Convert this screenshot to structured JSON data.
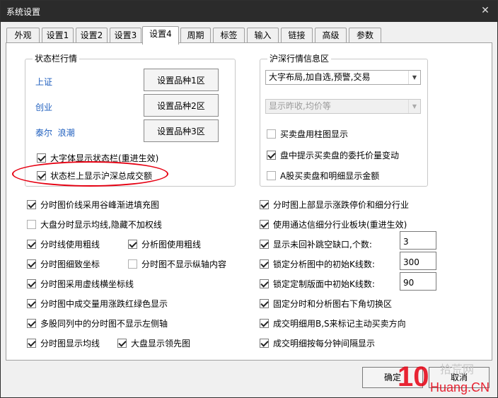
{
  "window": {
    "title": "系统设置",
    "close_glyph": "✕"
  },
  "tabs": [
    {
      "label": "外观",
      "active": false
    },
    {
      "label": "设置1",
      "active": false
    },
    {
      "label": "设置2",
      "active": false
    },
    {
      "label": "设置3",
      "active": false
    },
    {
      "label": "设置4",
      "active": true
    },
    {
      "label": "周期",
      "active": false
    },
    {
      "label": "标签",
      "active": false
    },
    {
      "label": "输入",
      "active": false
    },
    {
      "label": "链接",
      "active": false
    },
    {
      "label": "高级",
      "active": false
    },
    {
      "label": "参数",
      "active": false
    }
  ],
  "statusbar_group": {
    "title": "状态栏行情",
    "rows": [
      {
        "label": "上证",
        "button": "设置品种1区"
      },
      {
        "label": "创业",
        "button": "设置品种2区"
      },
      {
        "label": "泰尔  浪潮",
        "button": "设置品种3区"
      }
    ],
    "checks": [
      {
        "label": "大字体显示状态栏(重进生效)",
        "checked": true
      },
      {
        "label": "状态栏上显示沪深总成交额",
        "checked": true
      }
    ]
  },
  "hushen_group": {
    "title": "沪深行情信息区",
    "combo1": "大字布局,加自选,预警,交易",
    "combo2": "显示昨收,均价等",
    "checks": [
      {
        "label": "买卖盘用柱图显示",
        "checked": false
      },
      {
        "label": "盘中提示买卖盘的委托价量变动",
        "checked": true
      },
      {
        "label": "A股买卖盘和明细显示金额",
        "checked": false
      }
    ]
  },
  "left_options": {
    "row1": {
      "label": "分时图价线采用谷峰渐进填充图",
      "checked": true
    },
    "row2": {
      "label": "大盘分时显示均线,隐藏不加权线",
      "checked": false
    },
    "row3a": {
      "label": "分时线使用粗线",
      "checked": true
    },
    "row3b": {
      "label": "分析图使用粗线",
      "checked": true
    },
    "row4a": {
      "label": "分时图细致坐标",
      "checked": true
    },
    "row4b": {
      "label": "分时图不显示纵轴内容",
      "checked": false
    },
    "row5": {
      "label": "分时图采用虚线横坐标线",
      "checked": true
    },
    "row6": {
      "label": "分时图中成交量用涨跌红绿色显示",
      "checked": true
    },
    "row7": {
      "label": "多股同列中的分时图不显示左侧轴",
      "checked": true
    },
    "row8a": {
      "label": "分时图显示均线",
      "checked": true
    },
    "row8b": {
      "label": "大盘显示领先图",
      "checked": true
    }
  },
  "right_options": {
    "row1": {
      "label": "分时图上部显示涨跌停价和细分行业",
      "checked": true
    },
    "row2": {
      "label": "使用通达信细分行业板块(重进生效)",
      "checked": true
    },
    "row3": {
      "label": "显示未回补跳空缺口,个数:",
      "checked": true,
      "value": "3"
    },
    "row4": {
      "label": "锁定分析图中的初始K线数:",
      "checked": true,
      "value": "300"
    },
    "row5": {
      "label": "锁定定制版面中初始K线数:",
      "checked": true,
      "value": "90"
    },
    "row6": {
      "label": "固定分时和分析图右下角切换区",
      "checked": true
    },
    "row7": {
      "label": "成交明细用B,S来标记主动买卖方向",
      "checked": true
    },
    "row8": {
      "label": "成交明细按每分钟间隔显示",
      "checked": true
    }
  },
  "footer": {
    "ok": "确定",
    "cancel": "取消"
  },
  "watermark": {
    "number": "10",
    "text1": "拾荒网",
    "text2": "Huang.CN",
    "color": "#e60012"
  },
  "colors": {
    "accent_blue": "#1f5fbf",
    "highlight_red": "#e60012"
  }
}
